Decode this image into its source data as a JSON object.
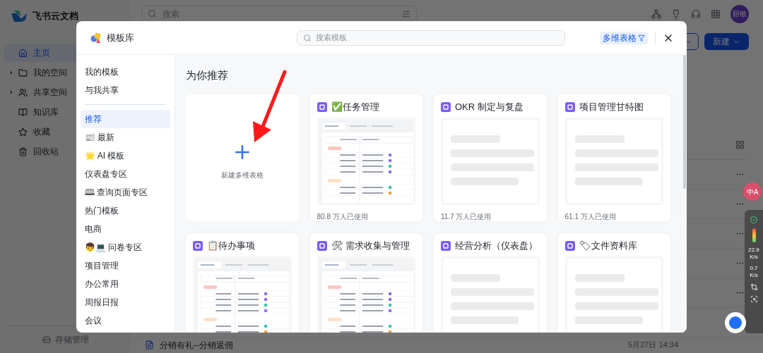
{
  "app": {
    "logo_text": "飞书云文档",
    "search_placeholder": "搜索",
    "avatar": "丽敏",
    "new_button": "新建",
    "nav": [
      {
        "label": "主页",
        "selected": true,
        "expandable": false,
        "kind": "home"
      },
      {
        "label": "我的空间",
        "selected": false,
        "expandable": true,
        "kind": "folder"
      },
      {
        "label": "共享空间",
        "selected": false,
        "expandable": true,
        "kind": "people"
      },
      {
        "label": "知识库",
        "selected": false,
        "expandable": false,
        "kind": "book"
      },
      {
        "label": "收藏",
        "selected": false,
        "expandable": false,
        "kind": "star"
      },
      {
        "label": "回收站",
        "selected": false,
        "expandable": false,
        "kind": "trash"
      }
    ],
    "storage": "存储管理",
    "file_row": {
      "name": "分销有礼--分销返佣",
      "time": "5月27日 14:34"
    },
    "translate_badge": "中A",
    "net_monitor": [
      {
        "value": "22.9",
        "unit": "K/s"
      },
      {
        "value": "0.7",
        "unit": "K/s"
      }
    ]
  },
  "modal": {
    "title": "模板库",
    "search_placeholder": "搜索模板",
    "filter": "多维表格",
    "categories": [
      {
        "label": "我的模板",
        "selected": false
      },
      {
        "label": "与我共享",
        "selected": false
      },
      {
        "label": "推荐",
        "selected": true
      },
      {
        "label": "📰 最新",
        "selected": false
      },
      {
        "label": "🌟 AI 模板",
        "selected": false
      },
      {
        "label": "仪表盘专区",
        "selected": false
      },
      {
        "label": "🕮 查询页面专区",
        "selected": false
      },
      {
        "label": "热门模板",
        "selected": false
      },
      {
        "label": "电商",
        "selected": false
      },
      {
        "label": "👦💻 问卷专区",
        "selected": false
      },
      {
        "label": "项目管理",
        "selected": false
      },
      {
        "label": "办公常用",
        "selected": false
      },
      {
        "label": "周报日报",
        "selected": false
      },
      {
        "label": "会议",
        "selected": false
      }
    ],
    "section_title": "为你推荐",
    "new_card": {
      "label": "新建多维表格"
    },
    "templates": [
      {
        "title": "✅任务管理",
        "kind": "table",
        "usage": "80.8 万人已使用"
      },
      {
        "title": "OKR 制定与复盘",
        "kind": "skeleton",
        "usage": "11.7 万人已使用"
      },
      {
        "title": "项目管理甘特图",
        "kind": "skeleton",
        "usage": "61.1 万人已使用"
      },
      {
        "title": "📋待办事项",
        "kind": "table"
      },
      {
        "title": "🛠 需求收集与管理",
        "kind": "table"
      },
      {
        "title": "经营分析（仪表盘）",
        "kind": "skeleton"
      },
      {
        "title": "🏷文件资料库",
        "kind": "skeleton"
      }
    ]
  }
}
